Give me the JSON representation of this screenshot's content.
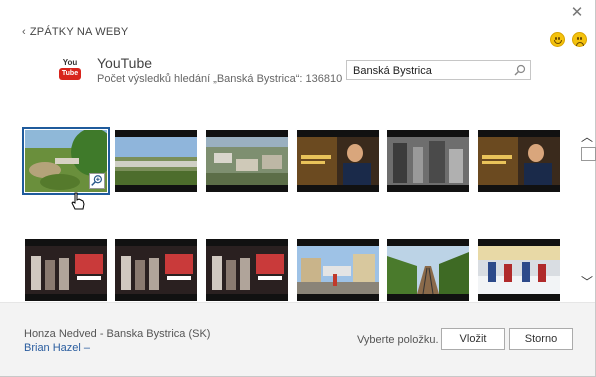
{
  "dialog": {
    "close_glyph": "✕",
    "back_label": "ZPÁTKY NA WEBY",
    "back_chevron": "‹"
  },
  "feedback": {
    "happy_icon": "smiley-happy-icon",
    "sad_icon": "smiley-sad-icon"
  },
  "provider": {
    "logo_top": "You",
    "logo_bottom": "Tube",
    "name": "YouTube",
    "result_text": "Počet výsledků hledání „Banská Bystrica“: 136810"
  },
  "search": {
    "value": "Banská Bystrica",
    "icon": "search-icon"
  },
  "results": [
    {
      "scene": "nature"
    },
    {
      "scene": "city"
    },
    {
      "scene": "aerial"
    },
    {
      "scene": "speaker"
    },
    {
      "scene": "crowd"
    },
    {
      "scene": "speaker"
    },
    {
      "scene": "promo"
    },
    {
      "scene": "promo"
    },
    {
      "scene": "promo"
    },
    {
      "scene": "street"
    },
    {
      "scene": "railway"
    },
    {
      "scene": "hockey"
    }
  ],
  "scroll": {
    "up_glyph": "︿",
    "down_glyph": "﹀"
  },
  "footer": {
    "credit_title": "Honza Nedved - Banska Bystrica (SK)",
    "credit_author": "Brian Hazel –",
    "status": "Vyberte položku.",
    "insert_label": "Vložit",
    "cancel_label": "Storno"
  },
  "colors": {
    "accent": "#1f5b9c",
    "youtube_red": "#d8241c",
    "link": "#2a5d9f",
    "footer_bg": "#f3f3f3"
  }
}
